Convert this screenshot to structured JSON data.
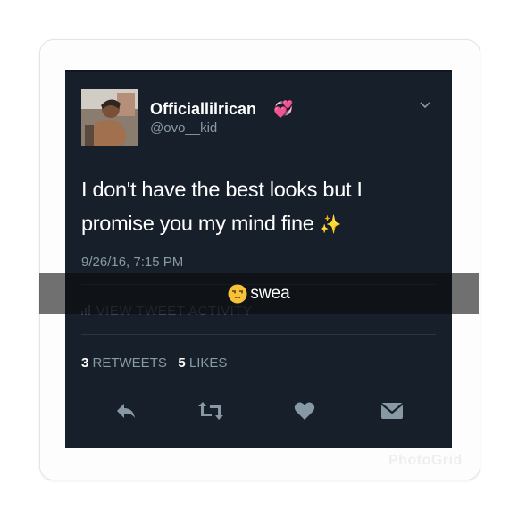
{
  "tweet": {
    "display_name": "Officiallilrican",
    "name_emoji": "💞",
    "handle": "@ovo__kid",
    "text": "I don't have the best looks but I promise you my mind fine",
    "text_emoji": "✨",
    "timestamp": "9/26/16, 7:15 PM",
    "activity_label": "VIEW TWEET ACTIVITY",
    "retweets_count": "3",
    "retweets_label": "RETWEETS",
    "likes_count": "5",
    "likes_label": "LIKES"
  },
  "actions": [
    "reply-icon",
    "retweet-icon",
    "like-icon",
    "dm-icon"
  ],
  "overlay_caption": {
    "emoji_icon": "unamused-face-icon",
    "text": "swea"
  },
  "watermark": "PhotoGrid",
  "colors": {
    "tweet_bg": "#17202a",
    "secondary_text": "#8899a6",
    "icon": "#8899a6"
  }
}
